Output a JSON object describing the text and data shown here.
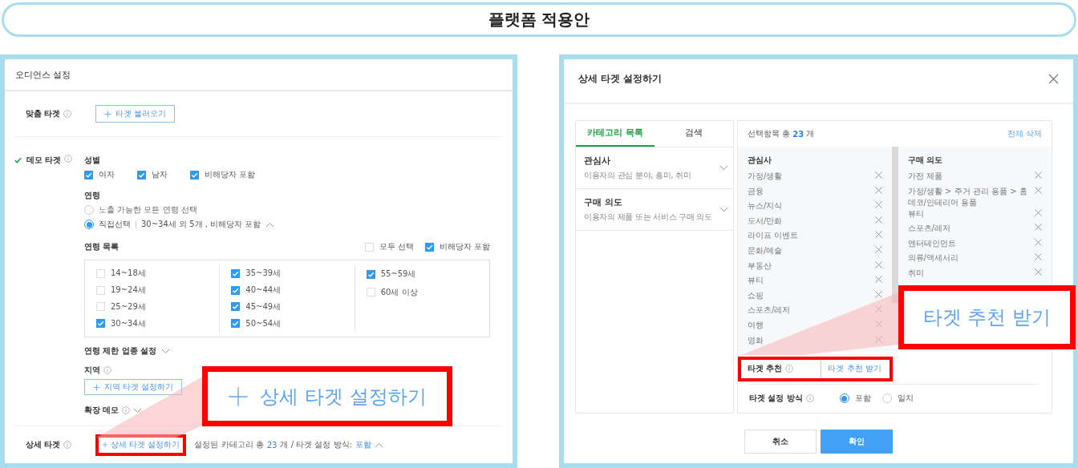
{
  "title": "플랫폼 적용안",
  "left": {
    "header": "오디언스 설정",
    "custom_target": {
      "label": "맞춤 타겟",
      "button": "타겟 불러오기"
    },
    "demo_target": {
      "label": "데모 타겟",
      "checked": true,
      "gender": {
        "label": "성별",
        "options": [
          {
            "label": "여자",
            "checked": true
          },
          {
            "label": "남자",
            "checked": true
          },
          {
            "label": "비해당자 포함",
            "checked": true
          }
        ]
      },
      "age": {
        "label": "연령",
        "options": [
          {
            "label": "노출 가능한 모든 연령 선택",
            "selected": false
          },
          {
            "label": "직접선택",
            "selected": true,
            "summary": "30~34세 외 5개 , 비해당자 포함"
          }
        ],
        "list_label": "연령 목록",
        "select_all": {
          "label": "모두 선택",
          "checked": false
        },
        "include_na": {
          "label": "비해당자 포함",
          "checked": true
        },
        "columns": [
          [
            {
              "label": "14~18세",
              "checked": false
            },
            {
              "label": "19~24세",
              "checked": false
            },
            {
              "label": "25~29세",
              "checked": false
            },
            {
              "label": "30~34세",
              "checked": true
            }
          ],
          [
            {
              "label": "35~39세",
              "checked": true
            },
            {
              "label": "40~44세",
              "checked": true
            },
            {
              "label": "45~49세",
              "checked": true
            },
            {
              "label": "50~54세",
              "checked": true
            }
          ],
          [
            {
              "label": "55~59세",
              "checked": true
            },
            {
              "label": "60세 이상",
              "checked": false
            }
          ]
        ]
      },
      "restricted": "연령 제한 업종 설정",
      "region": {
        "label": "지역",
        "button": "지역 타겟 설정하기"
      },
      "extended": "확장 데모"
    },
    "detail_target": {
      "label": "상세 타겟",
      "button": "상세 타겟 설정하기",
      "prefix": "설정된 카테고리 총",
      "count": "23",
      "mid": "개 / 타겟 설정 방식:",
      "method": "포함"
    },
    "callout": "상세 타겟 설정하기"
  },
  "right": {
    "header": "상세 타겟 설정하기",
    "tabs": [
      {
        "label": "카테고리 목록",
        "selected": true
      },
      {
        "label": "검색",
        "selected": false
      }
    ],
    "categories": [
      {
        "title": "관심사",
        "description": "이용자의 관심 분야, 흥미, 취미"
      },
      {
        "title": "구매 의도",
        "description": "이용자의 제품 또는 서비스 구매 의도"
      }
    ],
    "selection": {
      "prefix": "선택항목 총",
      "count": "23",
      "suffix": "개",
      "clear": "전체 삭제"
    },
    "groups": [
      {
        "title": "관심사",
        "items": [
          "가정/생활",
          "금융",
          "뉴스/지식",
          "도서/만화",
          "라이프 이벤트",
          "문화/예술",
          "부동산",
          "뷰티",
          "쇼핑",
          "스포츠/레저",
          "여행",
          "영화"
        ]
      },
      {
        "title": "구매 의도",
        "items": [
          "가전 제품",
          "가정/생활 > 주거 관리 용품 > 홈 데코/인테리어 용품",
          "뷰티",
          "스포츠/레저",
          "엔터테인먼트",
          "의류/액세서리",
          "취미"
        ]
      }
    ],
    "recommend": {
      "label": "타겟 추천",
      "button": "타겟 추천 받기"
    },
    "method": {
      "label": "타겟 설정 방식",
      "options": [
        {
          "label": "포함",
          "selected": true
        },
        {
          "label": "일치",
          "selected": false
        }
      ]
    },
    "buttons": [
      {
        "label": "취소",
        "kind": "secondary"
      },
      {
        "label": "확인",
        "kind": "primary"
      }
    ],
    "callout": "타겟 추천 받기"
  }
}
